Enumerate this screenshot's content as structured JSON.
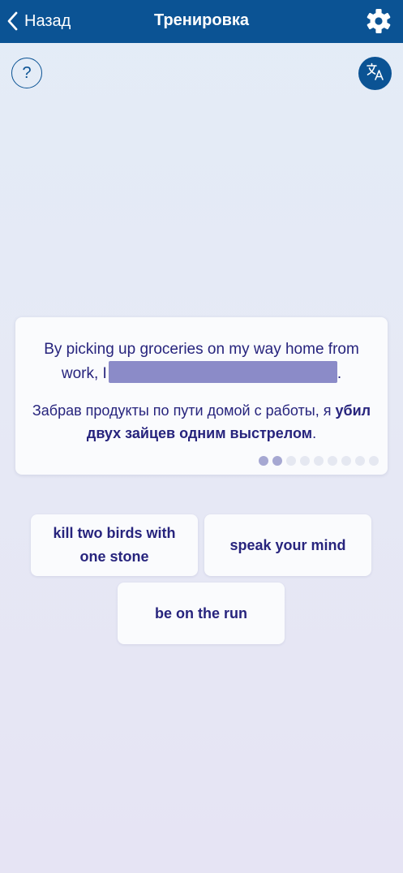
{
  "header": {
    "back_label": "Назад",
    "title": "Тренировка",
    "settings_icon": "gear-icon",
    "back_icon": "chevron-left-icon"
  },
  "toolbar": {
    "help_label": "?",
    "translate_icon": "translate-icon"
  },
  "card": {
    "sentence_en_before": "By picking up groceries on my way home from work, I",
    "sentence_en_after": ".",
    "sentence_ru_before": "Забрав продукты по пути домой с работы, я",
    "sentence_ru_phrase": "убил двух зайцев одним выстрелом",
    "sentence_ru_after": ".",
    "progress": {
      "total": 9,
      "completed": 2
    }
  },
  "options": [
    {
      "label": "kill two birds with one stone"
    },
    {
      "label": "speak your mind"
    },
    {
      "label": "be on the run"
    }
  ],
  "colors": {
    "header": "#0b5394",
    "text": "#27247d",
    "blank": "#8b8bc8",
    "dot_done": "#a6a8d2",
    "dot_pending": "#e5e8f1"
  }
}
